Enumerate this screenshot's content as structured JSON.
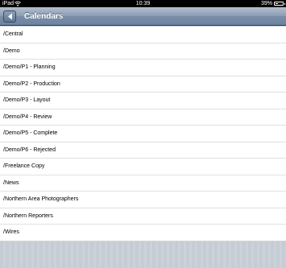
{
  "status_bar": {
    "device": "iPad",
    "time": "10:39",
    "battery_percent": "39%",
    "battery_level": 0.39
  },
  "nav": {
    "title": "Calendars",
    "back_icon": "chevron-left-icon"
  },
  "calendars": [
    {
      "label": "/Central"
    },
    {
      "label": "/Demo"
    },
    {
      "label": "/Demo/P1 - Planning"
    },
    {
      "label": "/Demo/P2 - Production"
    },
    {
      "label": "/Demo/P3 - Layout"
    },
    {
      "label": "/Demo/P4 - Review"
    },
    {
      "label": "/Demo/P5 - Complete"
    },
    {
      "label": "/Demo/P6 - Rejected"
    },
    {
      "label": "/Freelance Copy"
    },
    {
      "label": "/News"
    },
    {
      "label": "/Northern Area Photographers"
    },
    {
      "label": "/Northern Reporters"
    },
    {
      "label": "/Wires"
    }
  ],
  "colors": {
    "nav_bar": "#7a8ea7",
    "background_stripes": "#c5ccd4"
  }
}
